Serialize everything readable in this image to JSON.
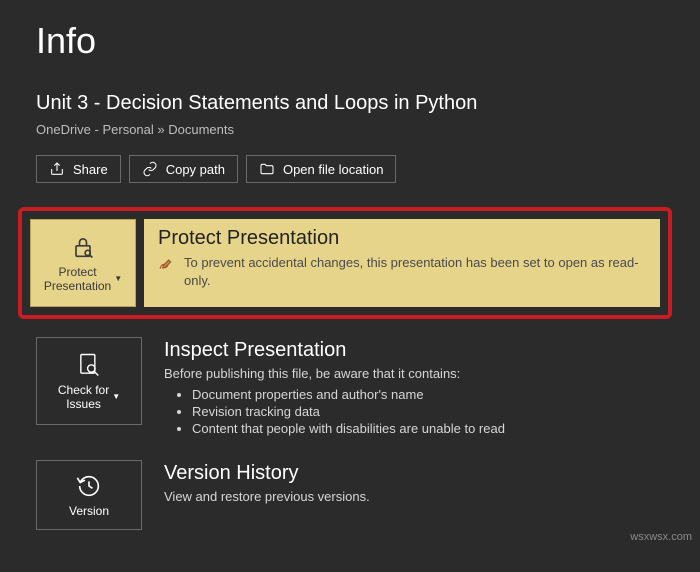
{
  "page": {
    "title": "Info",
    "doc_title": "Unit 3 - Decision Statements and Loops in Python",
    "breadcrumb": "OneDrive - Personal » Documents"
  },
  "toolbar": {
    "share": "Share",
    "copy_path": "Copy path",
    "open_location": "Open file location"
  },
  "protect": {
    "tile_line1": "Protect",
    "tile_line2": "Presentation",
    "heading": "Protect Presentation",
    "status": "To prevent accidental changes, this presentation has been set to open as read-only."
  },
  "inspect": {
    "tile_line1": "Check for",
    "tile_line2": "Issues",
    "heading": "Inspect Presentation",
    "lead": "Before publishing this file, be aware that it contains:",
    "items": [
      "Document properties and author's name",
      "Revision tracking data",
      "Content that people with disabilities are unable to read"
    ]
  },
  "version": {
    "tile_line1": "Version",
    "heading": "Version History",
    "desc": "View and restore previous versions."
  },
  "watermark": "wsxwsx.com"
}
